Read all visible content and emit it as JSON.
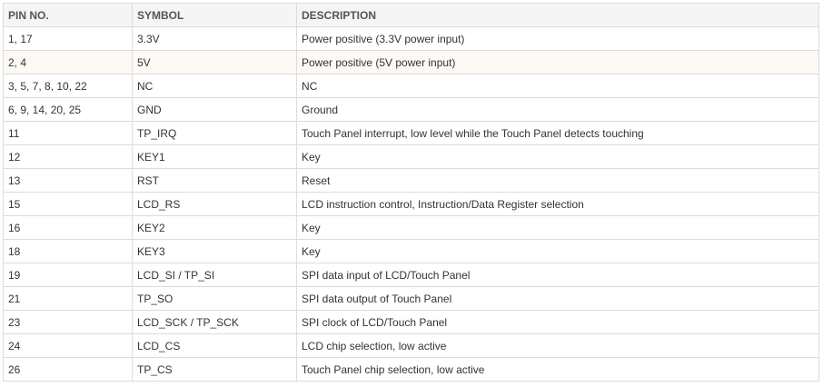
{
  "table": {
    "headers": [
      "PIN NO.",
      "SYMBOL",
      "DESCRIPTION"
    ],
    "rows": [
      [
        "1, 17",
        "3.3V",
        "Power positive (3.3V power input)"
      ],
      [
        "2, 4",
        "5V",
        "Power positive (5V power input)"
      ],
      [
        "3, 5, 7, 8, 10, 22",
        "NC",
        "NC"
      ],
      [
        "6, 9, 14, 20, 25",
        "GND",
        "Ground"
      ],
      [
        "11",
        "TP_IRQ",
        "Touch Panel interrupt, low level while the Touch Panel detects touching"
      ],
      [
        "12",
        "KEY1",
        "Key"
      ],
      [
        "13",
        "RST",
        "Reset"
      ],
      [
        "15",
        "LCD_RS",
        "LCD instruction control, Instruction/Data Register selection"
      ],
      [
        "16",
        "KEY2",
        "Key"
      ],
      [
        "18",
        "KEY3",
        "Key"
      ],
      [
        "19",
        "LCD_SI / TP_SI",
        "SPI data input of LCD/Touch Panel"
      ],
      [
        "21",
        "TP_SO",
        "SPI data output of Touch Panel"
      ],
      [
        "23",
        "LCD_SCK / TP_SCK",
        "SPI clock of LCD/Touch Panel"
      ],
      [
        "24",
        "LCD_CS",
        "LCD chip selection, low active"
      ],
      [
        "26",
        "TP_CS",
        "Touch Panel chip selection, low active"
      ]
    ],
    "highlighted_row": 1
  },
  "colors": {
    "border": "#dcdcdc",
    "header_bg": "#f5f5f5",
    "highlight_bg": "#fcf9f5",
    "text": "#333333"
  }
}
